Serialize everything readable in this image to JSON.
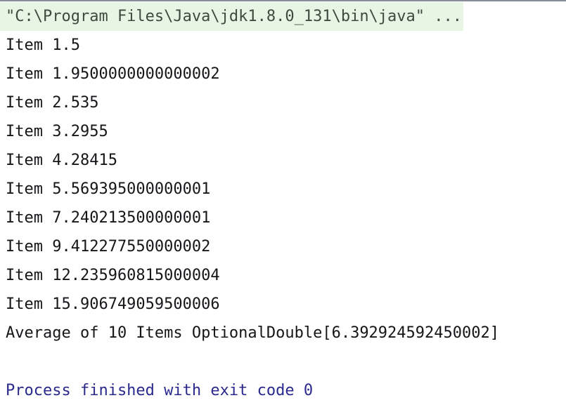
{
  "console": {
    "panel_title": "Run console output",
    "top_divider_color": "#868d96",
    "background_color": "#ffffff",
    "default_text_color": "#16161a",
    "command_highlight_color": "#e9f5e4",
    "command_text_color": "#3c4a3f",
    "exit_text_color": "#2a2a8e",
    "lines": [
      {
        "id": "command-line",
        "kind": "command",
        "text": "\"C:\\Program Files\\Java\\jdk1.8.0_131\\bin\\java\" ..."
      },
      {
        "id": "item-line-1",
        "kind": "output",
        "text": "Item 1.5"
      },
      {
        "id": "item-line-2",
        "kind": "output",
        "text": "Item 1.9500000000000002"
      },
      {
        "id": "item-line-3",
        "kind": "output",
        "text": "Item 2.535"
      },
      {
        "id": "item-line-4",
        "kind": "output",
        "text": "Item 3.2955"
      },
      {
        "id": "item-line-5",
        "kind": "output",
        "text": "Item 4.28415"
      },
      {
        "id": "item-line-6",
        "kind": "output",
        "text": "Item 5.569395000000001"
      },
      {
        "id": "item-line-7",
        "kind": "output",
        "text": "Item 7.240213500000001"
      },
      {
        "id": "item-line-8",
        "kind": "output",
        "text": "Item 9.412277550000002"
      },
      {
        "id": "item-line-9",
        "kind": "output",
        "text": "Item 12.235960815000004"
      },
      {
        "id": "item-line-10",
        "kind": "output",
        "text": "Item 15.906749059500006"
      },
      {
        "id": "average-line",
        "kind": "output",
        "text": "Average of 10 Items OptionalDouble[6.392924592450002]"
      },
      {
        "id": "blank-line",
        "kind": "blank",
        "text": ""
      },
      {
        "id": "exit-line",
        "kind": "exit",
        "text": "Process finished with exit code 0"
      }
    ],
    "summary": {
      "item_count": 10,
      "average_value": "6.392924592450002",
      "exit_code": "0"
    }
  }
}
